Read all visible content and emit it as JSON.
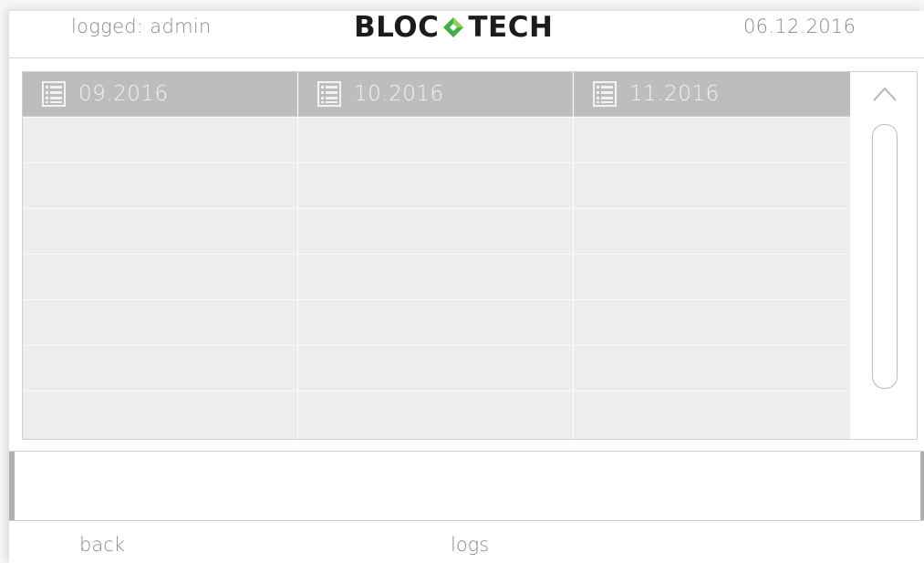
{
  "header": {
    "logged_user": "logged: admin",
    "logo_left": "BLOC",
    "logo_right": "TECH",
    "date": "06.12.2016"
  },
  "table": {
    "columns": [
      {
        "label": "09.2016",
        "icon": "list-icon"
      },
      {
        "label": "10.2016",
        "icon": "list-icon"
      },
      {
        "label": "11.2016",
        "icon": "list-icon"
      }
    ],
    "rows": [
      [
        "",
        "",
        ""
      ],
      [
        "",
        "",
        ""
      ],
      [
        "",
        "",
        ""
      ],
      [
        "",
        "",
        ""
      ],
      [
        "",
        "",
        ""
      ],
      [
        "",
        "",
        ""
      ],
      [
        "",
        "",
        ""
      ]
    ]
  },
  "scrollbar": {
    "up_icon": "chevron-up-icon"
  },
  "message": {
    "text": ""
  },
  "footer": {
    "back_label": "back",
    "logs_label": "logs"
  },
  "colors": {
    "header_cell": "#bdbdbd",
    "row_cell": "#ededed",
    "logo_green": "#3fae49",
    "logo_dark": "#1c1c1c",
    "text_gray": "#8a8a8a"
  }
}
